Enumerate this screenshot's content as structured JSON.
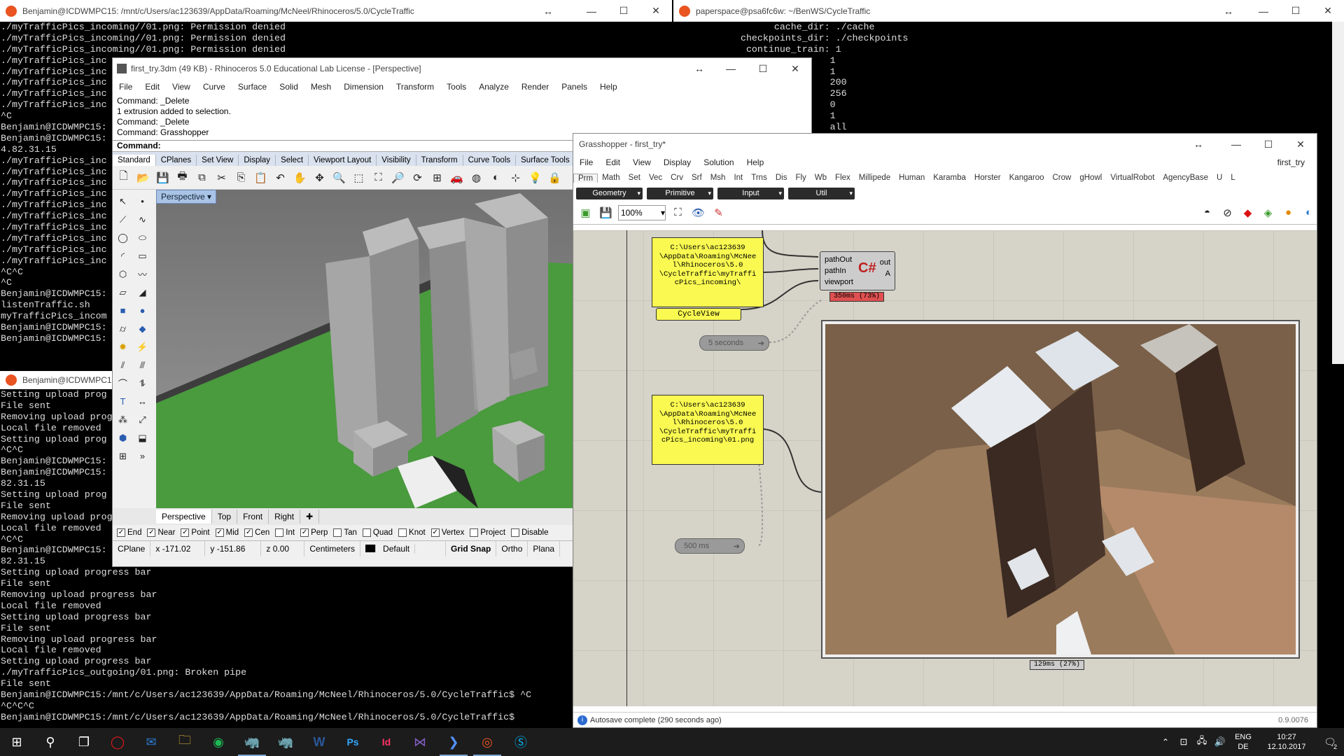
{
  "term1": {
    "title": "Benjamin@ICDWMPC15: /mnt/c/Users/ac123639/AppData/Roaming/McNeel/Rhinoceros/5.0/CycleTraffic",
    "lines": [
      "./myTrafficPics_incoming//01.png: Permission denied",
      "./myTrafficPics_incoming//01.png: Permission denied",
      "./myTrafficPics_incoming//01.png: Permission denied",
      "./myTrafficPics_inc",
      "./myTrafficPics_inc",
      "./myTrafficPics_inc",
      "./myTrafficPics_inc",
      "./myTrafficPics_inc",
      "^C",
      "Benjamin@ICDWMPC15:",
      "Benjamin@ICDWMPC15:",
      "4.82.31.15",
      "./myTrafficPics_inc",
      "./myTrafficPics_inc",
      "./myTrafficPics_inc",
      "./myTrafficPics_inc",
      "./myTrafficPics_inc",
      "./myTrafficPics_inc",
      "./myTrafficPics_inc",
      "./myTrafficPics_inc",
      "./myTrafficPics_inc",
      "./myTrafficPics_inc",
      "^C^C",
      "^C",
      "Benjamin@ICDWMPC15:",
      "listenTraffic.sh",
      "myTrafficPics_incom",
      "Benjamin@ICDWMPC15:",
      "Benjamin@ICDWMPC15:"
    ]
  },
  "term2": {
    "title": "paperspace@psa6fc6w: ~/BenWS/CycleTraffic",
    "lines": [
      "        cache_dir: ./cache",
      "  checkpoints_dir: ./checkpoints",
      "   continue_train: 1",
      "                  1",
      "                  1",
      "                  200",
      "                  256",
      "                  0",
      "                  1",
      "                  all"
    ]
  },
  "term3": {
    "title": "Benjamin@ICDWMPC15",
    "lines": [
      "Setting upload prog",
      "File sent",
      "Removing upload prog",
      "Local file removed",
      "Setting upload prog",
      "^C^C",
      "Benjamin@ICDWMPC15:",
      "Benjamin@ICDWMPC15:",
      "82.31.15",
      "Setting upload prog",
      "File sent",
      "Removing upload prog",
      "Local file removed",
      "^C^C",
      "Benjamin@ICDWMPC15:",
      "82.31.15",
      "Setting upload progress bar",
      "File sent",
      "Removing upload progress bar",
      "Local file removed",
      "Setting upload progress bar",
      "File sent",
      "Removing upload progress bar",
      "Local file removed",
      "Setting upload progress bar",
      "./myTrafficPics_outgoing/01.png: Broken pipe",
      "File sent",
      "Benjamin@ICDWMPC15:/mnt/c/Users/ac123639/AppData/Roaming/McNeel/Rhinoceros/5.0/CycleTraffic$ ^C",
      "^C^C^C",
      "Benjamin@ICDWMPC15:/mnt/c/Users/ac123639/AppData/Roaming/McNeel/Rhinoceros/5.0/CycleTraffic$"
    ]
  },
  "rhino": {
    "title": "first_try.3dm (49 KB) - Rhinoceros 5.0 Educational Lab License - [Perspective]",
    "menu": [
      "File",
      "Edit",
      "View",
      "Curve",
      "Surface",
      "Solid",
      "Mesh",
      "Dimension",
      "Transform",
      "Tools",
      "Analyze",
      "Render",
      "Panels",
      "Help"
    ],
    "history": [
      "Command: _Delete",
      "1 extrusion added to selection.",
      "Command: _Delete",
      "Command: Grasshopper"
    ],
    "command_label": "Command:",
    "tabs": [
      "Standard",
      "CPlanes",
      "Set View",
      "Display",
      "Select",
      "Viewport Layout",
      "Visibility",
      "Transform",
      "Curve Tools",
      "Surface Tools"
    ],
    "viewport_label": "Perspective",
    "view_tabs": [
      "Perspective",
      "Top",
      "Front",
      "Right"
    ],
    "osnaps": [
      {
        "label": "End",
        "checked": true
      },
      {
        "label": "Near",
        "checked": true
      },
      {
        "label": "Point",
        "checked": true
      },
      {
        "label": "Mid",
        "checked": true
      },
      {
        "label": "Cen",
        "checked": true
      },
      {
        "label": "Int",
        "checked": false
      },
      {
        "label": "Perp",
        "checked": true
      },
      {
        "label": "Tan",
        "checked": false
      },
      {
        "label": "Quad",
        "checked": false
      },
      {
        "label": "Knot",
        "checked": false
      },
      {
        "label": "Vertex",
        "checked": true
      },
      {
        "label": "Project",
        "checked": false
      },
      {
        "label": "Disable",
        "checked": false
      }
    ],
    "status": {
      "cplane": "CPlane",
      "x": "x -171.02",
      "y": "y -151.86",
      "z": "z 0.00",
      "units": "Centimeters",
      "layer": "Default",
      "grid_snap": "Grid Snap",
      "ortho": "Ortho",
      "planar": "Plana"
    }
  },
  "gh": {
    "title": "Grasshopper - first_try*",
    "menu": [
      "File",
      "Edit",
      "View",
      "Display",
      "Solution",
      "Help"
    ],
    "doc_name": "first_try",
    "tabs": [
      "Prm",
      "Math",
      "Set",
      "Vec",
      "Crv",
      "Srf",
      "Msh",
      "Int",
      "Trns",
      "Dis",
      "Fly",
      "Wb",
      "Flex",
      "Millipede",
      "Human",
      "Karamba",
      "Horster",
      "Kangaroo",
      "Crow",
      "gHowl",
      "VirtualRobot",
      "AgencyBase",
      "U",
      "L"
    ],
    "drops": [
      "Geometry",
      "Primitive",
      "Input",
      "Util"
    ],
    "zoom": "100%",
    "panel1": "C:\\Users\\ac123639\n\\AppData\\Roaming\\McNee\nl\\Rhinoceros\\5.0\n\\CycleTraffic\\myTraffi\ncPics_incoming\\",
    "panel2": "C:\\Users\\ac123639\n\\AppData\\Roaming\\McNee\nl\\Rhinoceros\\5.0\n\\CycleTraffic\\myTraffi\ncPics_incoming\\01.png",
    "cycleview": "CycleView",
    "csharp_inputs": [
      "pathOut",
      "pathIn",
      "viewport"
    ],
    "csharp_outputs": [
      "out",
      "A"
    ],
    "csharp_time": "350ms (73%)",
    "timer1": "5 seconds",
    "timer2": "500 ms",
    "image_time": "129ms (27%)",
    "status_text": "Autosave complete (290 seconds ago)",
    "version": "0.9.0076"
  },
  "taskbar": {
    "lang1": "ENG",
    "lang2": "DE",
    "time": "10:27",
    "date": "12.10.2017",
    "notif_count": "2"
  }
}
